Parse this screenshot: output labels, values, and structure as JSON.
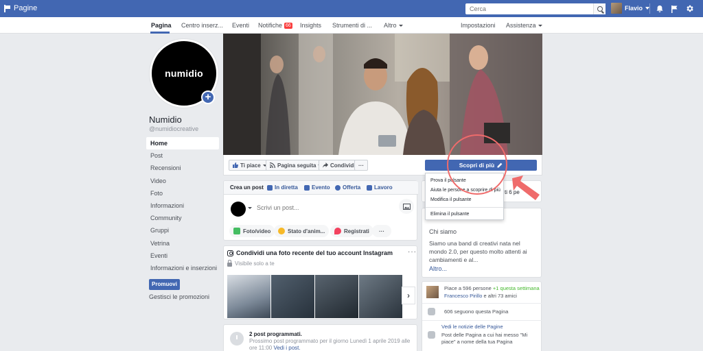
{
  "topbar": {
    "brand": "Pagine",
    "search_placeholder": "Cerca",
    "user_name": "Flavio",
    "icons": [
      "flag-icon",
      "search-icon",
      "bell-icon",
      "flag-icon",
      "gear-icon"
    ]
  },
  "nav": {
    "pagina": "Pagina",
    "centro": "Centro inserz...",
    "eventi": "Eventi",
    "notifiche": "Notifiche",
    "notifiche_badge": "66",
    "insights": "Insights",
    "strumenti": "Strumenti di ...",
    "altro": "Altro",
    "impostazioni": "Impostazioni",
    "assistenza": "Assistenza"
  },
  "profile": {
    "logo_text": "numidio",
    "name": "Numidio",
    "handle": "@numidiocreative"
  },
  "left_menu": {
    "items": [
      "Home",
      "Post",
      "Recensioni",
      "Video",
      "Foto",
      "Informazioni",
      "Community",
      "Gruppi",
      "Vetrina",
      "Eventi",
      "Informazioni e inserzioni"
    ],
    "promo_button": "Promuovi",
    "manage_promo": "Gestisci le promozioni"
  },
  "actions": {
    "like": "Ti piace",
    "follow": "Pagina seguita",
    "share": "Condividi",
    "more": "···",
    "cta": "Scopri di più"
  },
  "dropdown": {
    "items": [
      "Prova il pulsante",
      "Aiuta le persone a scoprire di più",
      "Modifica il pulsante"
    ],
    "delete": "Elimina il pulsante"
  },
  "composer": {
    "tabs": [
      "Crea un post",
      "In diretta",
      "Evento",
      "Offerta",
      "Lavoro"
    ],
    "placeholder": "Scrivi un post...",
    "pills": [
      "Foto/video",
      "Stato d'anim...",
      "Registrati"
    ],
    "more": "···"
  },
  "instagram": {
    "title": "Condividi una foto recente del tuo account Instagram",
    "visibility": "Visibile solo a te",
    "more": "···",
    "next": "›"
  },
  "scheduled": {
    "title": "2 post programmati.",
    "text": "Prossimo post programmato per il giorno Lunedì 1 aprile 2019 alle ore 11:00",
    "link": "Vedi i post."
  },
  "right": {
    "likes_snippet": "ti 6 pe",
    "about_heading": "Chi siamo",
    "about_text": "Siamo una band di creativi nata nel mondo 2.0, per questo molto attenti ai cambiamenti e al...",
    "about_more": "Altro...",
    "likes_line_prefix": "Piace a 596 persone",
    "likes_line_green": "+1 questa settimana",
    "friends_name": "Francesco Pirillo",
    "friends_rest": "e altri 73 amici",
    "followers": "606 seguono questa Pagina",
    "news_title": "Vedi le notizie delle Pagine",
    "news_text": "Post delle Pagina a cui hai messo \"Mi piace\" a nome della tua Pagina"
  },
  "colors": {
    "brand_blue": "#4267b2",
    "badge_red": "#fa3e3e",
    "annotation_red": "#ef6b6b",
    "green": "#42b72a",
    "link": "#365899"
  }
}
